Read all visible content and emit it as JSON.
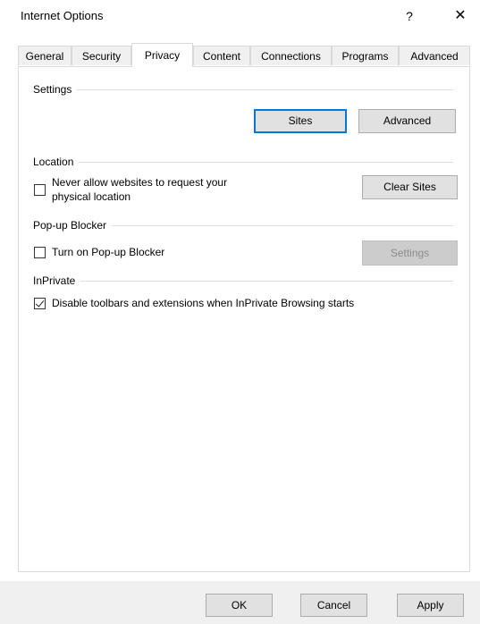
{
  "window": {
    "title": "Internet Options",
    "help_glyph": "?",
    "close_glyph": "✕"
  },
  "tabs": [
    {
      "label": "General"
    },
    {
      "label": "Security"
    },
    {
      "label": "Privacy",
      "active": true
    },
    {
      "label": "Content"
    },
    {
      "label": "Connections"
    },
    {
      "label": "Programs"
    },
    {
      "label": "Advanced"
    }
  ],
  "settings": {
    "heading": "Settings",
    "sites_button": "Sites",
    "advanced_button": "Advanced"
  },
  "location": {
    "heading": "Location",
    "checkbox_label_line1": "Never allow websites to request your",
    "checkbox_label_line2": "physical location",
    "checked": false,
    "clear_sites_button": "Clear Sites"
  },
  "popup_blocker": {
    "heading": "Pop-up Blocker",
    "checkbox_label": "Turn on Pop-up Blocker",
    "checked": false,
    "settings_button": "Settings",
    "settings_enabled": false
  },
  "inprivate": {
    "heading": "InPrivate",
    "checkbox_label": "Disable toolbars and extensions when InPrivate Browsing starts",
    "checked": true
  },
  "footer": {
    "ok_button": "OK",
    "cancel_button": "Cancel",
    "apply_button": "Apply"
  }
}
